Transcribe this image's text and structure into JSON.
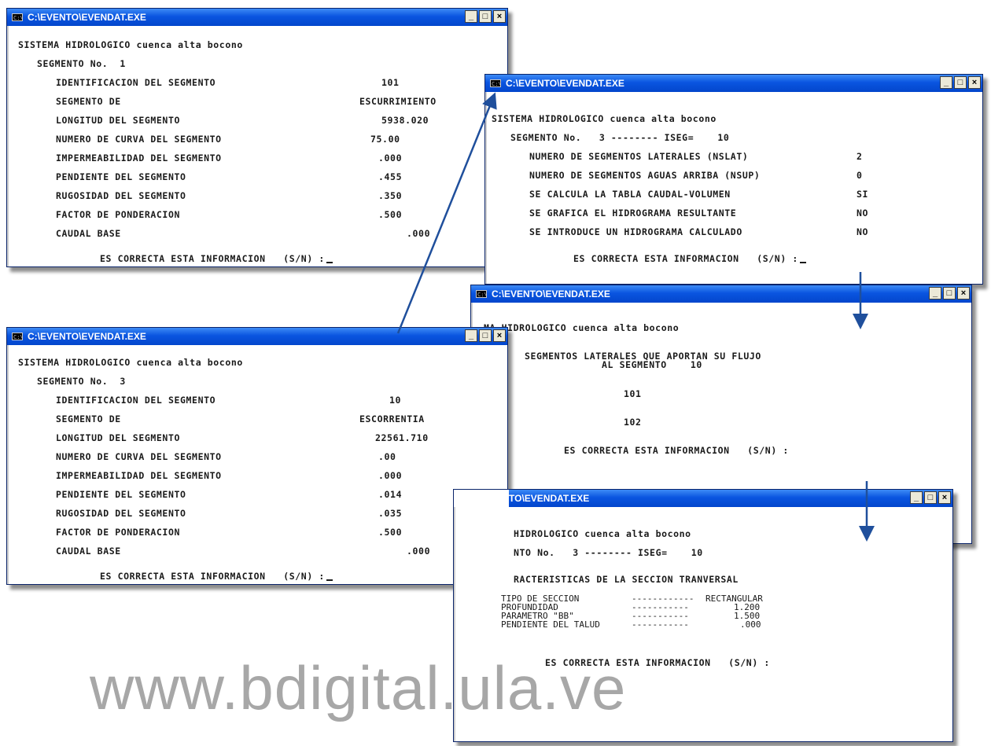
{
  "windows": {
    "w1": {
      "title": "C:\\EVENTO\\EVENDAT.EXE",
      "header": "SISTEMA HIDROLOGICO cuenca alta bocono",
      "segment": "SEGMENTO No.  1",
      "rows": [
        {
          "label": "IDENTIFICACION DEL SEGMENTO",
          "value": "101"
        },
        {
          "label": "SEGMENTO DE",
          "value": "ESCURRIMIENTO"
        },
        {
          "label": "LONGITUD DEL SEGMENTO",
          "value": "5938.020"
        },
        {
          "label": "NUMERO DE CURVA DEL SEGMENTO",
          "value": "75.00"
        },
        {
          "label": "IMPERMEABILIDAD DEL SEGMENTO",
          "value": ".000"
        },
        {
          "label": "PENDIENTE DEL SEGMENTO",
          "value": ".455"
        },
        {
          "label": "RUGOSIDAD DEL SEGMENTO",
          "value": ".350"
        },
        {
          "label": "FACTOR DE PONDERACION",
          "value": ".500"
        },
        {
          "label": "CAUDAL BASE",
          "value": ".000"
        }
      ],
      "prompt": "ES CORRECTA ESTA INFORMACION   (S/N) :"
    },
    "w2": {
      "title": "C:\\EVENTO\\EVENDAT.EXE",
      "header": "SISTEMA HIDROLOGICO cuenca alta bocono",
      "segment": "SEGMENTO No.   3 -------- ISEG=    10",
      "rows": [
        {
          "label": "NUMERO DE SEGMENTOS LATERALES (NSLAT)",
          "value": "2"
        },
        {
          "label": "NUMERO DE SEGMENTOS AGUAS ARRIBA (NSUP)",
          "value": "0"
        },
        {
          "label": "SE CALCULA LA TABLA CAUDAL-VOLUMEN",
          "value": "SI"
        },
        {
          "label": "SE GRAFICA EL HIDROGRAMA RESULTANTE",
          "value": "NO"
        },
        {
          "label": "SE INTRODUCE UN HIDROGRAMA CALCULADO",
          "value": "NO"
        }
      ],
      "prompt": "ES CORRECTA ESTA INFORMACION   (S/N) :"
    },
    "w3": {
      "title": "C:\\EVENTO\\EVENDAT.EXE",
      "header": "SISTEMA HIDROLOGICO cuenca alta bocono",
      "segment": "SEGMENTO No.  3",
      "rows": [
        {
          "label": "IDENTIFICACION DEL SEGMENTO",
          "value": "10"
        },
        {
          "label": "SEGMENTO DE",
          "value": "ESCORRENTIA"
        },
        {
          "label": "LONGITUD DEL SEGMENTO",
          "value": "22561.710"
        },
        {
          "label": "NUMERO DE CURVA DEL SEGMENTO",
          "value": ".00"
        },
        {
          "label": "IMPERMEABILIDAD DEL SEGMENTO",
          "value": ".000"
        },
        {
          "label": "PENDIENTE DEL SEGMENTO",
          "value": ".014"
        },
        {
          "label": "RUGOSIDAD DEL SEGMENTO",
          "value": ".035"
        },
        {
          "label": "FACTOR DE PONDERACION",
          "value": ".500"
        },
        {
          "label": "CAUDAL BASE",
          "value": ".000"
        }
      ],
      "prompt": "ES CORRECTA ESTA INFORMACION   (S/N) :"
    },
    "w4": {
      "title": "C:\\EVENTO\\EVENDAT.EXE",
      "header": "MA HIDROLOGICO cuenca alta bocono",
      "lateral_line1": "SEGMENTOS LATERALES QUE APORTAN SU FLUJO",
      "lateral_line2": "AL SEGMENTO    10",
      "laterals": [
        "101",
        "102"
      ],
      "prompt": "ES CORRECTA ESTA INFORMACION   (S/N) :"
    },
    "w5": {
      "title": "TO\\EVENDAT.EXE",
      "header": "HIDROLOGICO cuenca alta bocono",
      "segment": "NTO No.   3 -------- ISEG=    10",
      "section_title": "RACTERISTICAS DE LA SECCION TRANVERSAL",
      "section_rows": [
        {
          "label": "TIPO DE SECCION",
          "dashes": "------------",
          "value": "RECTANGULAR"
        },
        {
          "label": "PROFUNDIDAD",
          "dashes": "-----------",
          "value": "1.200"
        },
        {
          "label": "PARAMETRO \"BB\"",
          "dashes": "-----------",
          "value": "1.500"
        },
        {
          "label": "PENDIENTE DEL TALUD",
          "dashes": "-----------",
          "value": ".000"
        }
      ],
      "prompt": "ES CORRECTA ESTA INFORMACION   (S/N) :"
    }
  },
  "buttons": {
    "minimize": "_",
    "maximize": "□",
    "close": "×"
  },
  "icon_text": "C:\\",
  "watermark": "www.bdigital.ula.ve",
  "arrow_color": "#1f4f9c"
}
